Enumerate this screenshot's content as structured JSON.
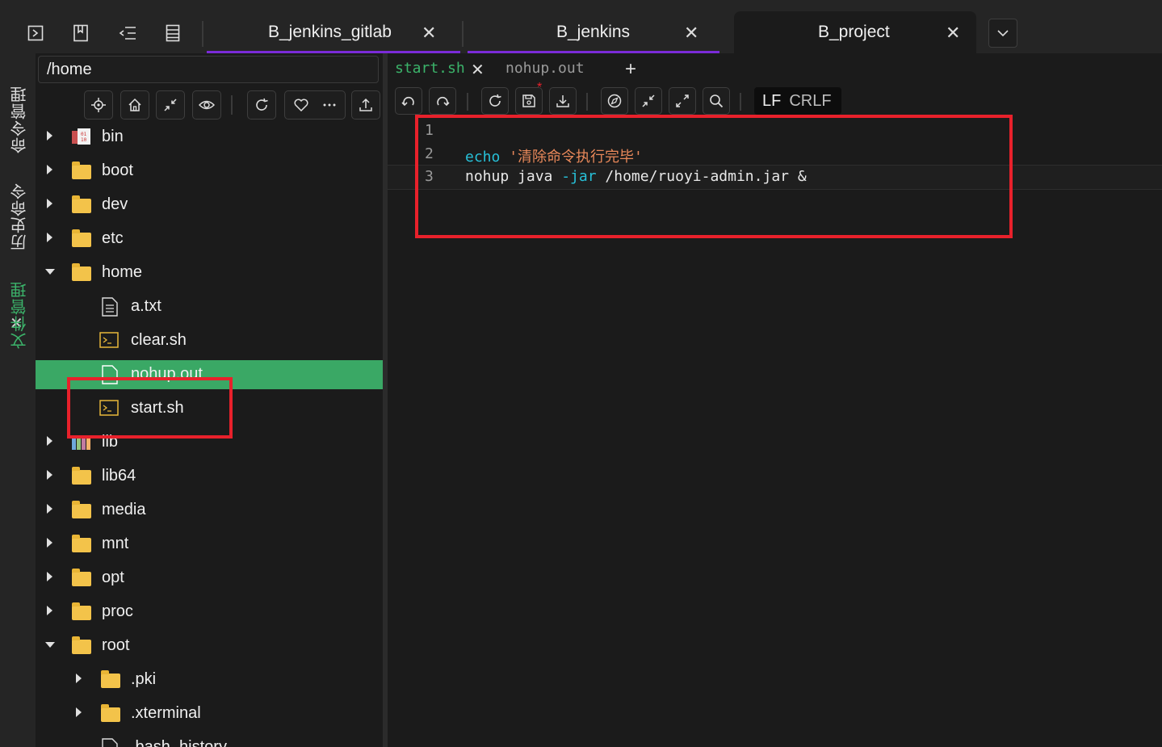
{
  "session_tabs": [
    {
      "label": "B_jenkins_gitlab",
      "active": false
    },
    {
      "label": "B_jenkins",
      "active": false
    },
    {
      "label": "B_project",
      "active": true
    }
  ],
  "sidebar_vertical": {
    "command_manager": "命令管理",
    "history_commands": "历史命令",
    "file_manager": "文件管理"
  },
  "file_panel": {
    "path": "/home",
    "tree": [
      {
        "name": "bin",
        "type": "folder-special",
        "expand": "collapsed",
        "depth": 0
      },
      {
        "name": "boot",
        "type": "folder",
        "expand": "collapsed",
        "depth": 0
      },
      {
        "name": "dev",
        "type": "folder",
        "expand": "collapsed",
        "depth": 0
      },
      {
        "name": "etc",
        "type": "folder",
        "expand": "collapsed",
        "depth": 0
      },
      {
        "name": "home",
        "type": "folder",
        "expand": "expanded",
        "depth": 0
      },
      {
        "name": "a.txt",
        "type": "text-file",
        "expand": "none",
        "depth": 1
      },
      {
        "name": "clear.sh",
        "type": "script-file",
        "expand": "none",
        "depth": 1
      },
      {
        "name": "nohup.out",
        "type": "file",
        "expand": "none",
        "depth": 1,
        "selected": true
      },
      {
        "name": "start.sh",
        "type": "script-file",
        "expand": "none",
        "depth": 1
      },
      {
        "name": "lib",
        "type": "folder-lib",
        "expand": "collapsed",
        "depth": 0
      },
      {
        "name": "lib64",
        "type": "folder",
        "expand": "collapsed",
        "depth": 0
      },
      {
        "name": "media",
        "type": "folder",
        "expand": "collapsed",
        "depth": 0
      },
      {
        "name": "mnt",
        "type": "folder",
        "expand": "collapsed",
        "depth": 0
      },
      {
        "name": "opt",
        "type": "folder",
        "expand": "collapsed",
        "depth": 0
      },
      {
        "name": "proc",
        "type": "folder",
        "expand": "collapsed",
        "depth": 0
      },
      {
        "name": "root",
        "type": "folder",
        "expand": "expanded",
        "depth": 0
      },
      {
        "name": ".pki",
        "type": "folder",
        "expand": "collapsed",
        "depth": 1
      },
      {
        "name": ".xterminal",
        "type": "folder",
        "expand": "collapsed",
        "depth": 1
      },
      {
        "name": ".bash_history",
        "type": "file",
        "expand": "none",
        "depth": 1
      }
    ]
  },
  "editor": {
    "tabs": [
      {
        "label": "start.sh",
        "active": true
      },
      {
        "label": "nohup.out",
        "active": false
      }
    ],
    "add_tab": "+",
    "line_endings": [
      "LF",
      "CRLF"
    ],
    "lines": [
      {
        "num": "1",
        "parts": []
      },
      {
        "num": "2",
        "parts": [
          {
            "t": "echo",
            "c": "kw"
          },
          {
            "t": " ",
            "c": ""
          },
          {
            "t": "'清除命令执行完毕'",
            "c": "str"
          }
        ]
      },
      {
        "num": "3",
        "parts": [
          {
            "t": "nohup java ",
            "c": ""
          },
          {
            "t": "-jar",
            "c": "kw"
          },
          {
            "t": " /home/ruoyi-admin.jar &",
            "c": ""
          }
        ]
      }
    ]
  },
  "colors": {
    "accent_purple": "#7a2bd8",
    "selection_green": "#3aa865",
    "highlight_red": "#e8212b"
  }
}
